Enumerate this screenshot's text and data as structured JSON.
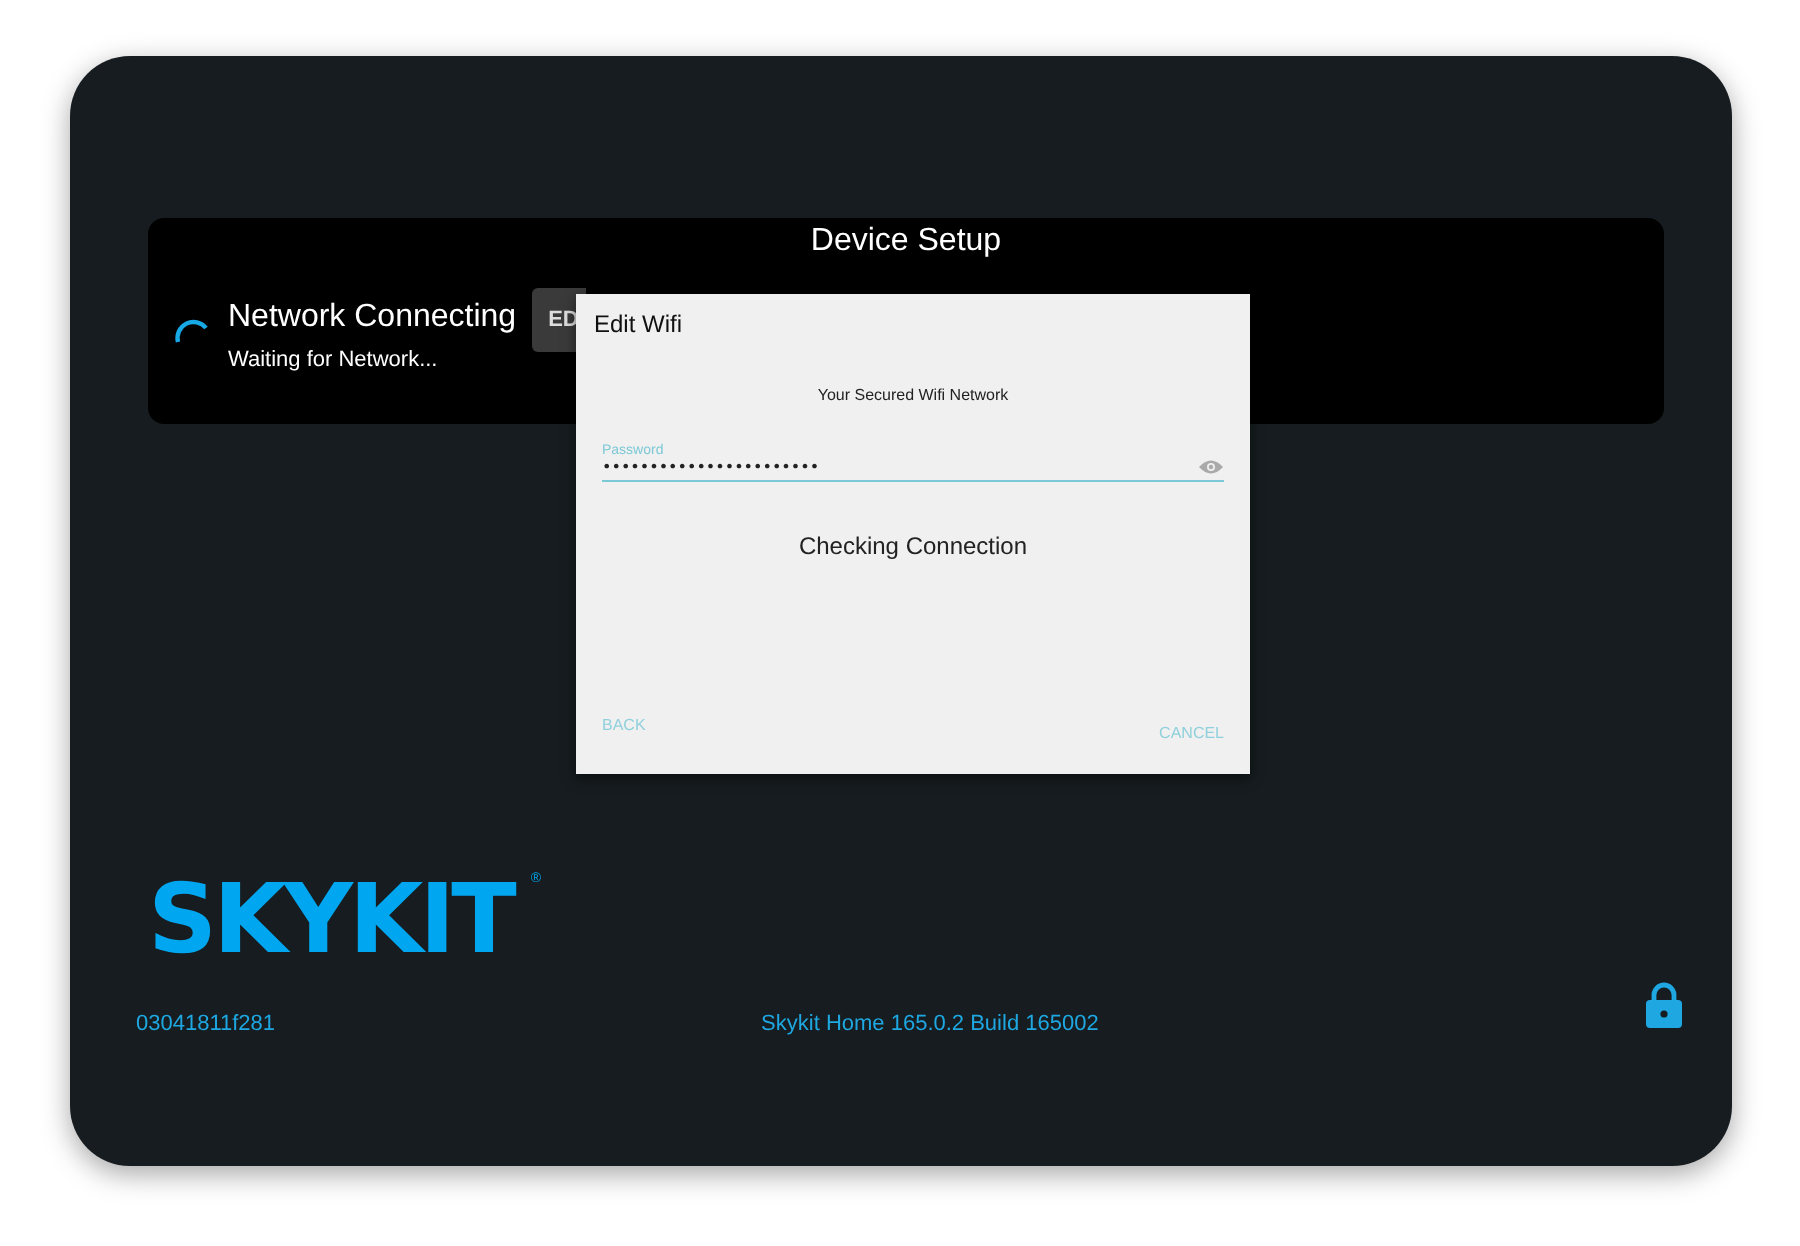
{
  "header": {
    "title": "Device Setup",
    "status": "Network Connecting",
    "substatus": "Waiting for Network...",
    "button": "ED"
  },
  "dialog": {
    "title": "Edit Wifi",
    "network": "Your Secured Wifi Network",
    "password": {
      "label": "Password",
      "value": "•••••••••••••••••••••••"
    },
    "message": "Checking Connection",
    "buttons": [
      "BACK",
      "CANCEL"
    ]
  },
  "brand": {
    "logo": "SKYKIT",
    "mark": "®"
  },
  "footer": {
    "device_id": "03041811f281",
    "version": "Skykit Home 165.0.2 Build 165002"
  }
}
